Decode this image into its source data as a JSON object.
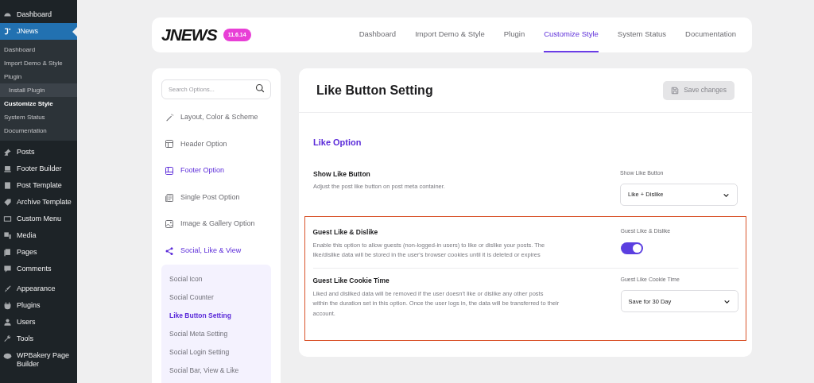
{
  "admin_menu": [
    {
      "label": "Dashboard",
      "current": false
    },
    {
      "label": "JNews",
      "current": true,
      "submenu": [
        {
          "label": "Dashboard",
          "selected": false,
          "hovered": false
        },
        {
          "label": "Import Demo & Style",
          "selected": false,
          "hovered": false
        },
        {
          "label": "Plugin",
          "selected": false,
          "hovered": false,
          "children": [
            {
              "label": "Install Plugin",
              "selected": false,
              "hovered": true
            }
          ]
        },
        {
          "label": "Customize Style",
          "selected": true,
          "hovered": false
        },
        {
          "label": "System Status",
          "selected": false,
          "hovered": false
        },
        {
          "label": "Documentation",
          "selected": false,
          "hovered": false
        }
      ]
    },
    {
      "label": "Posts",
      "current": false
    },
    {
      "label": "Footer Builder",
      "current": false
    },
    {
      "label": "Post Template",
      "current": false
    },
    {
      "label": "Archive Template",
      "current": false
    },
    {
      "label": "Custom Menu",
      "current": false
    },
    {
      "label": "Media",
      "current": false
    },
    {
      "label": "Pages",
      "current": false
    },
    {
      "label": "Comments",
      "current": false
    },
    {
      "label": "Appearance",
      "current": false
    },
    {
      "label": "Plugins",
      "current": false
    },
    {
      "label": "Users",
      "current": false
    },
    {
      "label": "Tools",
      "current": false
    },
    {
      "label": "WPBakery Page Builder",
      "current": false
    }
  ],
  "header": {
    "logo": "JNEWS",
    "version": "11.6.14",
    "tabs": [
      {
        "label": "Dashboard",
        "selected": false
      },
      {
        "label": "Import Demo & Style",
        "selected": false
      },
      {
        "label": "Plugin",
        "selected": false
      },
      {
        "label": "Customize Style",
        "selected": true
      },
      {
        "label": "System Status",
        "selected": false
      },
      {
        "label": "Documentation",
        "selected": false
      }
    ]
  },
  "options_nav": {
    "search": {
      "placeholder": "Search Options..."
    },
    "items": [
      {
        "label": "Layout, Color & Scheme",
        "active": false
      },
      {
        "label": "Header Option",
        "active": false
      },
      {
        "label": "Footer Option",
        "active": true
      },
      {
        "label": "Single Post Option",
        "active": false
      },
      {
        "label": "Image & Gallery Option",
        "active": false
      },
      {
        "label": "Social, Like & View",
        "active": true,
        "expanded": true,
        "children": [
          {
            "label": "Social Icon",
            "selected": false
          },
          {
            "label": "Social Counter",
            "selected": false
          },
          {
            "label": "Like Button Setting",
            "selected": true
          },
          {
            "label": "Social Meta Setting",
            "selected": false
          },
          {
            "label": "Social Login Setting",
            "selected": false
          },
          {
            "label": "Social Bar, View & Like",
            "selected": false
          }
        ]
      }
    ]
  },
  "panel": {
    "title": "Like Button Setting",
    "save_button": {
      "label": "Save changes",
      "disabled": true
    },
    "section": "Like Option",
    "groups": [
      {
        "highlighted": false,
        "settings": [
          {
            "kind": "select",
            "title": "Show Like Button",
            "description": "Adjust the post like button on post meta container.",
            "control_label": "Show Like Button",
            "value": "Like + Dislike"
          }
        ]
      },
      {
        "highlighted": true,
        "settings": [
          {
            "kind": "toggle",
            "title": "Guest Like & Dislike",
            "description": "Enable this option to allow guests (non-logged-in users) to like or dislike your posts. The like/dislike data will be stored in the user's browser cookies until it is deleted or expires",
            "control_label": "Guest Like & Dislike",
            "on": true
          },
          {
            "kind": "select",
            "title": "Guest Like Cookie Time",
            "description": "Liked and disliked data will be removed if the user doesn't like or dislike any other posts within the duration set in this option. Once the user logs in, the data will be transferred to their account.",
            "control_label": "Guest Like Cookie Time",
            "value": "Save for 30 Day"
          }
        ]
      }
    ]
  }
}
